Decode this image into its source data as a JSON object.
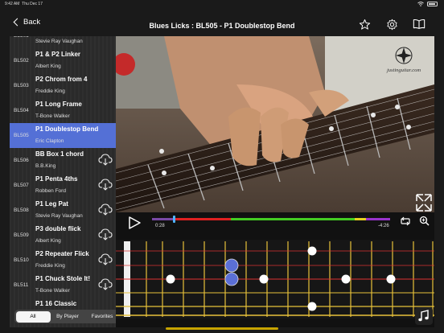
{
  "status": {
    "time": "9:42 AM",
    "date": "Thu Dec 17"
  },
  "nav": {
    "back_label": "Back",
    "title": "Blues Licks : BL505 - P1 Doublestop Bend"
  },
  "lessons": [
    {
      "code": "BL501",
      "name": "",
      "artist": "Stevie Ray Vaughan",
      "download": false,
      "active": false
    },
    {
      "code": "BL502",
      "name": "P1 & P2 Linker",
      "artist": "Albert King",
      "download": false,
      "active": false
    },
    {
      "code": "BL503",
      "name": "P2 Chrom from 4",
      "artist": "Freddie King",
      "download": false,
      "active": false
    },
    {
      "code": "BL504",
      "name": "P1 Long Frame",
      "artist": "T-Bone Walker",
      "download": false,
      "active": false
    },
    {
      "code": "BL505",
      "name": "P1 Doublestop Bend",
      "artist": "Eric Clapton",
      "download": false,
      "active": true
    },
    {
      "code": "BL506",
      "name": "BB Box 1 chord",
      "artist": "B.B.King",
      "download": true,
      "active": false
    },
    {
      "code": "BL507",
      "name": "P1 Penta 4ths",
      "artist": "Robben Ford",
      "download": true,
      "active": false
    },
    {
      "code": "BL508",
      "name": "P1 Leg Pat",
      "artist": "Stevie Ray Vaughan",
      "download": true,
      "active": false
    },
    {
      "code": "BL509",
      "name": "P3 double flick",
      "artist": "Albert King",
      "download": true,
      "active": false
    },
    {
      "code": "BL510",
      "name": "P2 Repeater Flick",
      "artist": "Freddie King",
      "download": true,
      "active": false
    },
    {
      "code": "BL511",
      "name": "P1 Chuck Stole It!",
      "artist": "T-Bone Walker",
      "download": true,
      "active": false
    },
    {
      "code": "",
      "name": "P1 16 Classic",
      "artist": "",
      "download": false,
      "active": false
    }
  ],
  "filter_tabs": [
    "All",
    "By Player",
    "Favorites"
  ],
  "player": {
    "elapsed": "0:28",
    "remaining": "-4:26",
    "progress": 0.09
  },
  "video": {
    "watermark": "justinguitar.com"
  },
  "colors": {
    "accent": "#5470d6",
    "dot_blue": "#5b6fd6",
    "fret": "#e8c23a",
    "string_red": "#d33",
    "string_yellow": "#e8c23a"
  }
}
